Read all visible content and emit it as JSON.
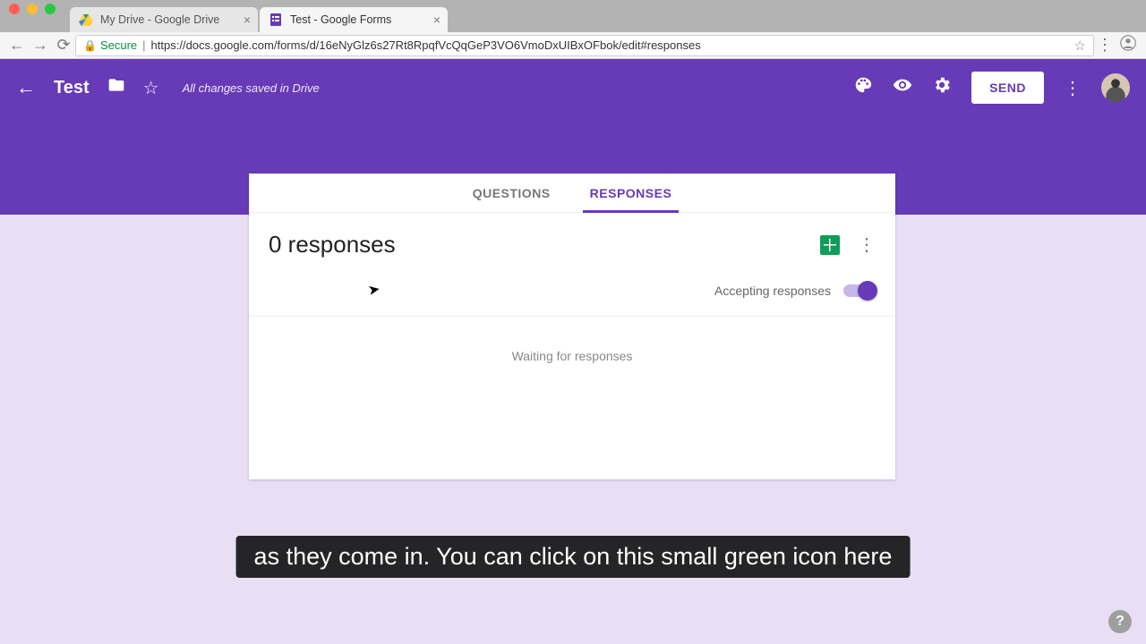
{
  "browser": {
    "tabs": [
      {
        "title": "My Drive - Google Drive",
        "active": false
      },
      {
        "title": "Test - Google Forms",
        "active": true
      }
    ],
    "secure_label": "Secure",
    "url": "https://docs.google.com/forms/d/16eNyGlz6s27Rt8RpqfVcQqGeP3VO6VmoDxUIBxOFbok/edit#responses"
  },
  "header": {
    "title": "Test",
    "saved_status": "All changes saved in Drive",
    "send_label": "SEND"
  },
  "tabs": {
    "questions": "QUESTIONS",
    "responses": "RESPONSES"
  },
  "responses": {
    "count_text": "0 responses",
    "accepting_label": "Accepting responses",
    "accepting": true,
    "waiting_text": "Waiting for responses"
  },
  "caption": "as they come in. You can click on this small green icon here",
  "help": "?"
}
